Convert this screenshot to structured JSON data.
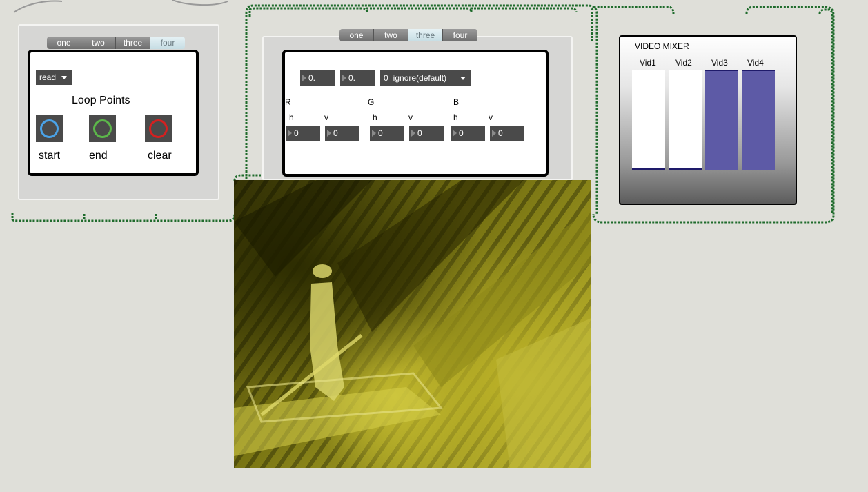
{
  "loop_panel": {
    "tabs": [
      {
        "label": "one",
        "active": false
      },
      {
        "label": "two",
        "active": false
      },
      {
        "label": "three",
        "active": false
      },
      {
        "label": "four",
        "active": true
      }
    ],
    "read_menu": "read",
    "title": "Loop Points",
    "buttons": [
      {
        "label": "start",
        "icon": "blue-ring-icon",
        "color": "#4aa3e8"
      },
      {
        "label": "end",
        "icon": "green-ring-icon",
        "color": "#5cb84a"
      },
      {
        "label": "clear",
        "icon": "red-ring-icon",
        "color": "#d42020"
      }
    ]
  },
  "rgb_panel": {
    "tabs": [
      {
        "label": "one",
        "active": false
      },
      {
        "label": "two",
        "active": false
      },
      {
        "label": "three",
        "active": true
      },
      {
        "label": "four",
        "active": false
      }
    ],
    "num1": "0.",
    "num2": "0.",
    "mode_menu": "0=ignore(default)",
    "channels": [
      {
        "name": "R",
        "h_label": "h",
        "v_label": "v",
        "h": "0",
        "v": "0"
      },
      {
        "name": "G",
        "h_label": "h",
        "v_label": "v",
        "h": "0",
        "v": "0"
      },
      {
        "name": "B",
        "h_label": "h",
        "v_label": "v",
        "h": "0",
        "v": "0"
      }
    ]
  },
  "video_mixer": {
    "title": "VIDEO MIXER",
    "channels": [
      {
        "label": "Vid1",
        "level": 0.0
      },
      {
        "label": "Vid2",
        "level": 0.0
      },
      {
        "label": "Vid3",
        "level": 1.0
      },
      {
        "label": "Vid4",
        "level": 1.0
      }
    ],
    "fill_color": "#5d5aa6"
  },
  "colors": {
    "background": "#dfdfd9",
    "patch_cord": "#2e8b3e"
  }
}
